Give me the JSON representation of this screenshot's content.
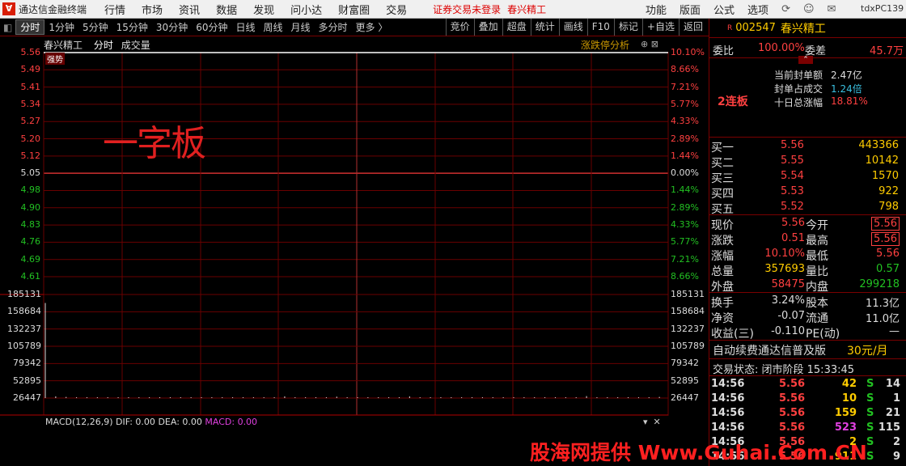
{
  "app": {
    "title": "通达信金融终端",
    "menu": [
      "行情",
      "市场",
      "资讯",
      "数据",
      "发现",
      "问小达",
      "财富圈",
      "交易"
    ],
    "notice": "证券交易未登录",
    "stock_name": "春兴精工",
    "right_menu": [
      "功能",
      "版面",
      "公式",
      "选项"
    ],
    "pc_name": "tdxPC139"
  },
  "tabs": [
    "分时",
    "1分钟",
    "5分钟",
    "15分钟",
    "30分钟",
    "60分钟",
    "日线",
    "周线",
    "月线",
    "多分时",
    "更多 〉"
  ],
  "active_tab": "分时",
  "tools": [
    "竞价",
    "叠加",
    "超盘",
    "统计",
    "画线",
    "F10",
    "标记",
    "+自选",
    "返回"
  ],
  "chart_header": {
    "name": "春兴精工",
    "type": "分时",
    "volume": "成交量",
    "zdt": "涨跌停分析"
  },
  "badge": "强势",
  "overlay_text": "一字板",
  "chart_data": {
    "type": "line",
    "title": "",
    "price_ticks": [
      "5.56",
      "5.49",
      "5.41",
      "5.34",
      "5.27",
      "5.20",
      "5.12",
      "5.05",
      "4.98",
      "4.90",
      "4.83",
      "4.76",
      "4.69",
      "4.61"
    ],
    "pct_ticks": [
      "10.10%",
      "8.66%",
      "7.21%",
      "5.77%",
      "4.33%",
      "2.89%",
      "1.44%",
      "0.00%",
      "1.44%",
      "2.89%",
      "4.33%",
      "5.77%",
      "7.21%",
      "8.66%"
    ],
    "prev_close": 5.05,
    "price_line": 5.56,
    "volume_ticks": [
      "185131",
      "158684",
      "132237",
      "105789",
      "79342",
      "52895",
      "26447"
    ],
    "volume_max": 185131,
    "volume_bars": [
      170000,
      3000,
      2000,
      1500,
      1200,
      1500,
      1000,
      1000,
      800,
      900,
      1200,
      800,
      700,
      600,
      500,
      600,
      500,
      400,
      500,
      600,
      700,
      500,
      400,
      3000,
      400,
      500,
      300,
      400,
      2500,
      500,
      400,
      600,
      400,
      300,
      400,
      3000,
      500,
      300,
      400,
      200,
      300,
      400,
      500,
      300,
      400,
      300,
      200,
      300,
      400,
      200,
      300,
      400,
      3500,
      400,
      300,
      200,
      300,
      400,
      500,
      2000
    ]
  },
  "macd": {
    "label": "MACD(12,26,9)",
    "dif": "DIF: 0.00",
    "dea": "DEA: 0.00",
    "macd": "MACD: 0.00"
  },
  "quote": {
    "r": "R",
    "code": "002547",
    "name": "春兴精工",
    "weibi_label": "委比",
    "weibi": "100.00%",
    "weicha_label": "委差",
    "weicha": "45.7万",
    "lianban": "2连板",
    "stats": [
      {
        "label": "当前封单额",
        "value": "2.47亿"
      },
      {
        "label": "封单占成交",
        "value": "1.24倍"
      },
      {
        "label": "十日总涨幅",
        "value": "18.81%"
      }
    ],
    "book": [
      {
        "label": "买一",
        "price": "5.56",
        "vol": "443366"
      },
      {
        "label": "买二",
        "price": "5.55",
        "vol": "10142"
      },
      {
        "label": "买三",
        "price": "5.54",
        "vol": "1570"
      },
      {
        "label": "买四",
        "price": "5.53",
        "vol": "922"
      },
      {
        "label": "买五",
        "price": "5.52",
        "vol": "798"
      }
    ],
    "info": [
      {
        "l1": "现价",
        "v1": "5.56",
        "l2": "今开",
        "v2": "5.56"
      },
      {
        "l1": "涨跌",
        "v1": "0.51",
        "l2": "最高",
        "v2": "5.56"
      },
      {
        "l1": "涨幅",
        "v1": "10.10%",
        "l2": "最低",
        "v2": "5.56"
      },
      {
        "l1": "总量",
        "v1": "357693",
        "l2": "量比",
        "v2": "0.57"
      },
      {
        "l1": "外盘",
        "v1": "58475",
        "l2": "内盘",
        "v2": "299218"
      }
    ],
    "info2": [
      {
        "l1": "换手",
        "v1": "3.24%",
        "l2": "股本",
        "v2": "11.3亿"
      },
      {
        "l1": "净资",
        "v1": "-0.07",
        "l2": "流通",
        "v2": "11.0亿"
      },
      {
        "l1": "收益(三)",
        "v1": "-0.110",
        "l2": "PE(动)",
        "v2": "—"
      }
    ],
    "promo": "自动续费通达信普及版",
    "promo_price": "30元/月",
    "status": "交易状态: 闭市阶段 15:33:45",
    "ticks": [
      {
        "t": "14:56",
        "p": "5.56",
        "v": "42",
        "s": "S",
        "n": "14"
      },
      {
        "t": "14:56",
        "p": "5.56",
        "v": "10",
        "s": "S",
        "n": "1"
      },
      {
        "t": "14:56",
        "p": "5.56",
        "v": "159",
        "s": "S",
        "n": "21"
      },
      {
        "t": "14:56",
        "p": "5.56",
        "v": "523",
        "s": "S",
        "n": "115"
      },
      {
        "t": "14:56",
        "p": "5.56",
        "v": "2",
        "s": "S",
        "n": "2"
      },
      {
        "t": "14:56",
        "p": "5.56",
        "v": "911",
        "s": "S",
        "n": "9"
      }
    ]
  },
  "watermark": "股海网提供 Www.Guhai.Com.CN"
}
